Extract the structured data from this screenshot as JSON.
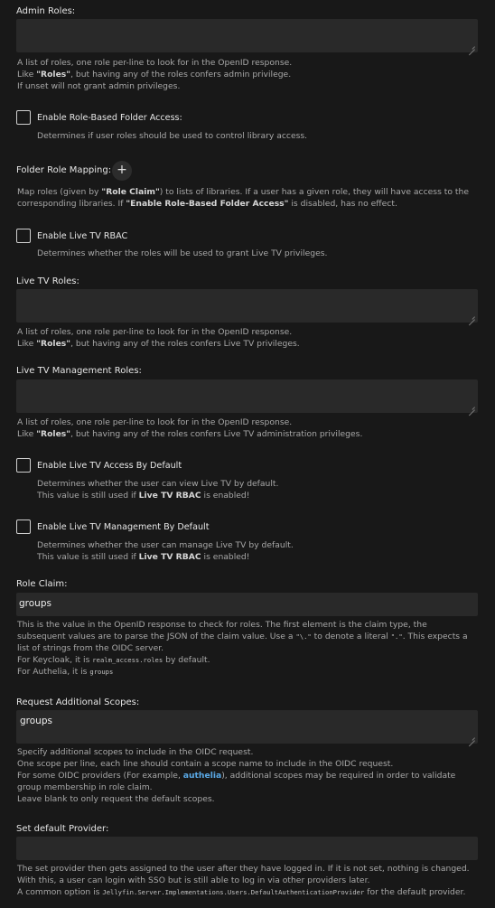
{
  "admin_roles": {
    "label": "Admin Roles:",
    "value": "",
    "desc": [
      "A list of roles, one role per-line to look for in the OpenID response.",
      "Like ",
      "\"Roles\"",
      ", but having any of the roles confers admin privilege.",
      "If unset will not grant admin privileges."
    ]
  },
  "enable_rbac_folder": {
    "label": "Enable Role-Based Folder Access:",
    "checked": false,
    "desc": "Determines if user roles should be used to control library access."
  },
  "folder_role_mapping": {
    "label": "Folder Role Mapping:",
    "add_icon": "+",
    "desc": [
      "Map roles (given by ",
      "\"Role Claim\"",
      ") to lists of libraries. If a user has a given role, they will have access to the",
      "corresponding libraries. If ",
      "\"Enable Role-Based Folder Access\"",
      " is disabled, has no effect."
    ]
  },
  "enable_live_tv_rbac": {
    "label": "Enable Live TV RBAC",
    "checked": false,
    "desc": "Determines whether the roles will be used to grant Live TV privileges."
  },
  "live_tv_roles": {
    "label": "Live TV Roles:",
    "value": "",
    "desc": [
      "A list of roles, one role per-line to look for in the OpenID response.",
      "Like ",
      "\"Roles\"",
      ", but having any of the roles confers Live TV privileges."
    ]
  },
  "live_tv_mgmt_roles": {
    "label": "Live TV Management Roles:",
    "value": "",
    "desc": [
      "A list of roles, one role per-line to look for in the OpenID response.",
      "Like ",
      "\"Roles\"",
      ", but having any of the roles confers Live TV administration privileges."
    ]
  },
  "live_tv_access_default": {
    "label": "Enable Live TV Access By Default",
    "checked": false,
    "desc": [
      "Determines whether the user can view Live TV by default.",
      "This value is still used if ",
      "Live TV RBAC",
      " is enabled!"
    ]
  },
  "live_tv_mgmt_default": {
    "label": "Enable Live TV Management By Default",
    "checked": false,
    "desc": [
      "Determines whether the user can manage Live TV by default.",
      "This value is still used if ",
      "Live TV RBAC",
      " is enabled!"
    ]
  },
  "role_claim": {
    "label": "Role Claim:",
    "value": "groups",
    "desc": [
      "This is the value in the OpenID response to check for roles. The first element is the claim type, the",
      "subsequent values are to parse the JSON of the claim value. Use a ",
      "\"\\.\"",
      " to denote a literal ",
      "\".\"",
      ". This expects a",
      "list of strings from the OIDC server.",
      "For Keycloak, it is ",
      "realm_access.roles",
      " by default.",
      "For Authelia, it is ",
      "groups"
    ]
  },
  "request_scopes": {
    "label": "Request Additional Scopes:",
    "value": "groups",
    "desc": [
      "Specify additional scopes to include in the OIDC request.",
      "One scope per line, each line should contain a scope name to include in the OIDC request.",
      "For some OIDC providers (For example, ",
      "authelia",
      "), additional scopes may be required in order to validate",
      "group membership in role claim.",
      "Leave blank to only request the default scopes."
    ]
  },
  "default_provider": {
    "label": "Set default Provider:",
    "value": "",
    "desc": [
      "The set provider then gets assigned to the user after they have logged in. If it is not set, nothing is changed.",
      "With this, a user can login with SSO but is still able to log in via other providers later.",
      "A common option is ",
      "Jellyfin.Server.Implementations.Users.DefaultAuthenticationProvider",
      " for the default provider."
    ]
  },
  "colors": {
    "background": "#181818",
    "input_bg": "#292929",
    "link": "#5aa9e6"
  }
}
